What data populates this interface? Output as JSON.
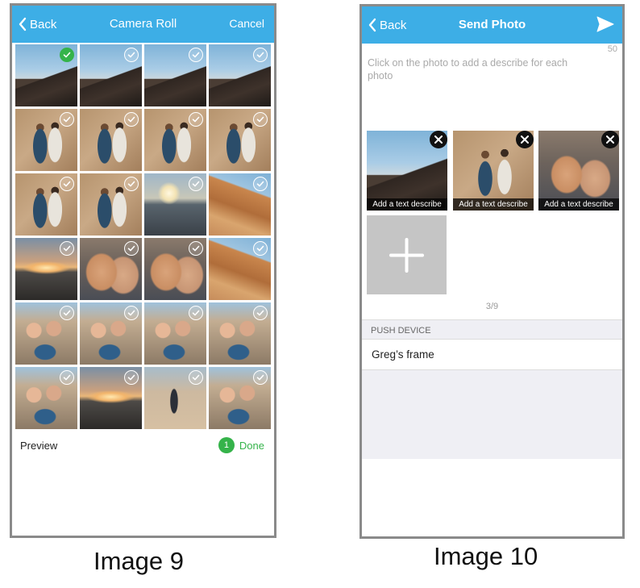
{
  "screen9": {
    "nav": {
      "back_label": "Back",
      "title": "Camera Roll",
      "cancel_label": "Cancel"
    },
    "photos": [
      {
        "kind": "rock",
        "selected": true
      },
      {
        "kind": "rock",
        "selected": false
      },
      {
        "kind": "rock",
        "selected": false
      },
      {
        "kind": "rock",
        "selected": false
      },
      {
        "kind": "kids",
        "selected": false
      },
      {
        "kind": "kids",
        "selected": false
      },
      {
        "kind": "kids",
        "selected": false
      },
      {
        "kind": "kids",
        "selected": false
      },
      {
        "kind": "kids",
        "selected": false
      },
      {
        "kind": "kids",
        "selected": false
      },
      {
        "kind": "beach-sun",
        "selected": false
      },
      {
        "kind": "cliff",
        "selected": false
      },
      {
        "kind": "sunset",
        "selected": false
      },
      {
        "kind": "selfie",
        "selected": false
      },
      {
        "kind": "selfie",
        "selected": false
      },
      {
        "kind": "cliff",
        "selected": false
      },
      {
        "kind": "family",
        "selected": false
      },
      {
        "kind": "family",
        "selected": false
      },
      {
        "kind": "family",
        "selected": false
      },
      {
        "kind": "family",
        "selected": false
      },
      {
        "kind": "family",
        "selected": false
      },
      {
        "kind": "sunset",
        "selected": false
      },
      {
        "kind": "beach",
        "selected": false
      },
      {
        "kind": "family",
        "selected": false
      }
    ],
    "footer": {
      "preview_label": "Preview",
      "done_count": "1",
      "done_label": "Done"
    }
  },
  "screen10": {
    "nav": {
      "back_label": "Back",
      "title": "Send Photo",
      "send_icon": "send-icon"
    },
    "char_limit": "50",
    "describe_placeholder": "Click on the photo to add a describe for each photo",
    "selected_photos": [
      {
        "kind": "rock",
        "caption": "Add a text describe"
      },
      {
        "kind": "kids",
        "caption": "Add a text describe"
      },
      {
        "kind": "selfie",
        "caption": "Add a text describe"
      }
    ],
    "photo_count": "3/9",
    "push_device_header": "PUSH DEVICE",
    "device_name": "Greg’s frame"
  },
  "captions": {
    "image9": "Image 9",
    "image10": "Image 10"
  },
  "colors": {
    "nav_blue": "#3daee6",
    "select_green": "#35b34a",
    "section_gray": "#efeff4"
  }
}
